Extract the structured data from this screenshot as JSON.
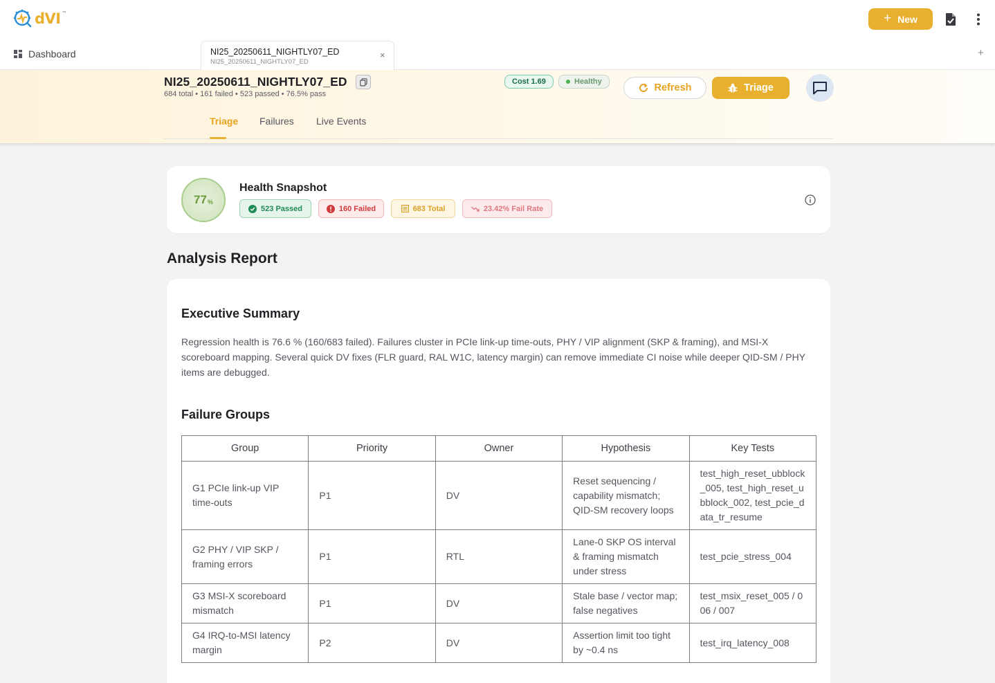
{
  "app": {
    "logo_text": "dVI",
    "logo_tm": "™",
    "new_button": "New"
  },
  "nav": {
    "dashboard_label": "Dashboard",
    "tab": {
      "title": "NI25_20250611_NIGHTLY07_ED",
      "subtitle": "NI25_20250611_NIGHTLY07_ED",
      "close": "×"
    },
    "add_tab": "+"
  },
  "run": {
    "title": "NI25_20250611_NIGHTLY07_ED",
    "summary": "684 total • 161 failed • 523 passed • 76.5% pass",
    "cost_badge": "Cost 1.69",
    "health_badge": "Healthy",
    "refresh_label": "Refresh",
    "triage_label": "Triage",
    "tabs": [
      {
        "label": "Triage",
        "active": true
      },
      {
        "label": "Failures",
        "active": false
      },
      {
        "label": "Live Events",
        "active": false
      }
    ]
  },
  "health": {
    "score": "77",
    "score_unit": "%",
    "title": "Health Snapshot",
    "passed": "523 Passed",
    "failed": "160 Failed",
    "total": "683 Total",
    "fail_rate": "23.42% Fail Rate"
  },
  "report": {
    "section_title": "Analysis Report",
    "exec_title": "Executive Summary",
    "exec_text": "Regression health is 76.6 % (160/683 failed). Failures cluster in PCIe link-up time-outs, PHY / VIP alignment (SKP & framing), and MSI-X scoreboard mapping. Several quick DV fixes (FLR guard, RAL W1C, latency margin) can remove immediate CI noise while deeper QID-SM / PHY items are debugged.",
    "groups_title": "Failure Groups",
    "columns": [
      "Group",
      "Priority",
      "Owner",
      "Hypothesis",
      "Key Tests"
    ],
    "rows": [
      [
        "G1 PCIe link-up VIP time-outs",
        "P1",
        "DV",
        "Reset sequencing / capability mismatch; QID-SM recovery loops",
        "test_high_reset_ubblock_005, test_high_reset_ubblock_002, test_pcie_data_tr_resume"
      ],
      [
        "G2 PHY / VIP SKP / framing errors",
        "P1",
        "RTL",
        "Lane-0 SKP OS interval & framing mismatch under stress",
        "test_pcie_stress_004"
      ],
      [
        "G3 MSI-X scoreboard mismatch",
        "P1",
        "DV",
        "Stale base / vector map; false negatives",
        "test_msix_reset_005 / 006 / 007"
      ],
      [
        "G4 IRQ-to-MSI latency margin",
        "P2",
        "DV",
        "Assertion limit too tight by ~0.4 ns",
        "test_irq_latency_008"
      ]
    ]
  },
  "colors": {
    "accent": "#e8b02e",
    "pass": "#1f8a52",
    "fail": "#cf3a3a"
  }
}
